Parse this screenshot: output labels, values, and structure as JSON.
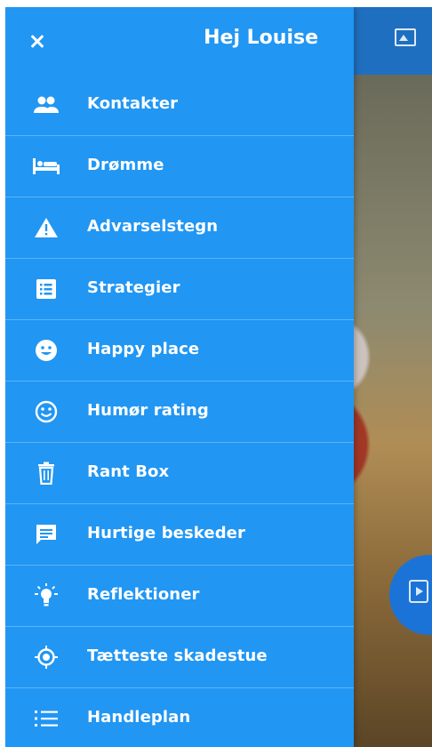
{
  "drawer": {
    "greeting": "Hej Louise",
    "close_icon": "close-icon",
    "items": [
      {
        "label": "Kontakter",
        "icon": "contacts-icon"
      },
      {
        "label": "Drømme",
        "icon": "bed-icon"
      },
      {
        "label": "Advarselstegn",
        "icon": "warning-icon"
      },
      {
        "label": "Strategier",
        "icon": "list-box-icon"
      },
      {
        "label": "Happy place",
        "icon": "smiley-filled-icon"
      },
      {
        "label": "Humør rating",
        "icon": "smiley-outline-icon"
      },
      {
        "label": "Rant Box",
        "icon": "trash-icon"
      },
      {
        "label": "Hurtige beskeder",
        "icon": "message-icon"
      },
      {
        "label": "Reflektioner",
        "icon": "lightbulb-icon"
      },
      {
        "label": "Tætteste skadestue",
        "icon": "target-icon"
      },
      {
        "label": "Handleplan",
        "icon": "list-icon"
      }
    ]
  },
  "colors": {
    "drawer_bg": "#2196f3",
    "header_bg": "#1f6fc0",
    "text": "#ffffff"
  }
}
